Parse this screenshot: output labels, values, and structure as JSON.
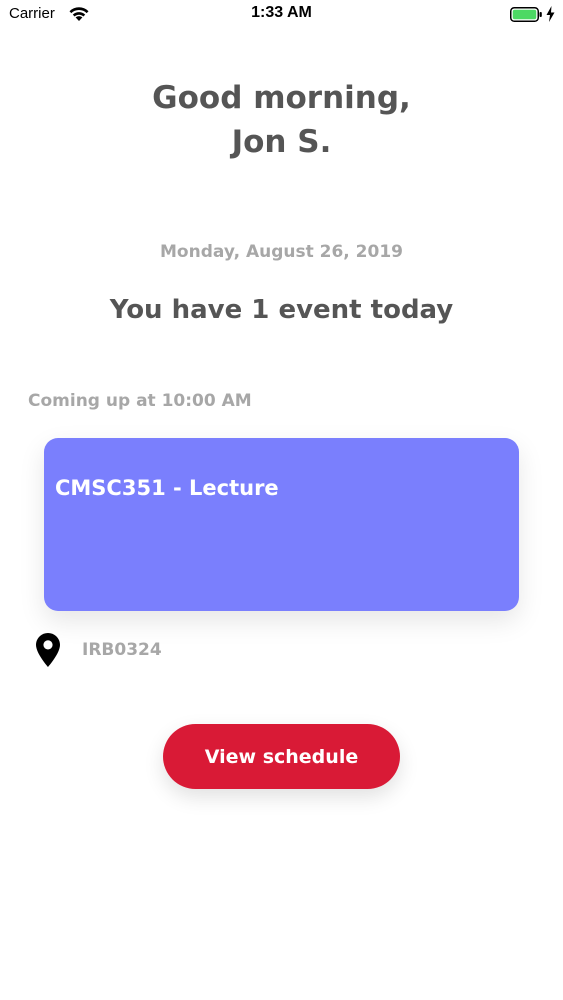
{
  "status_bar": {
    "carrier": "Carrier",
    "time": "1:33 AM",
    "battery_color": "#4cd964"
  },
  "greeting": {
    "line1": "Good morning,",
    "line2": "Jon S."
  },
  "date": "Monday, August 26, 2019",
  "events_summary": "You have 1 event today",
  "upcoming_label": "Coming up at 10:00 AM",
  "event": {
    "title": "CMSC351 - Lecture",
    "location": "IRB0324",
    "card_color": "#7a7ffd",
    "location_icon": "map-pin-icon"
  },
  "actions": {
    "view_schedule": "View schedule",
    "button_color": "#d91a36"
  },
  "icons": {
    "wifi": "wifi-icon",
    "battery": "battery-icon",
    "charging": "charging-bolt-icon"
  }
}
